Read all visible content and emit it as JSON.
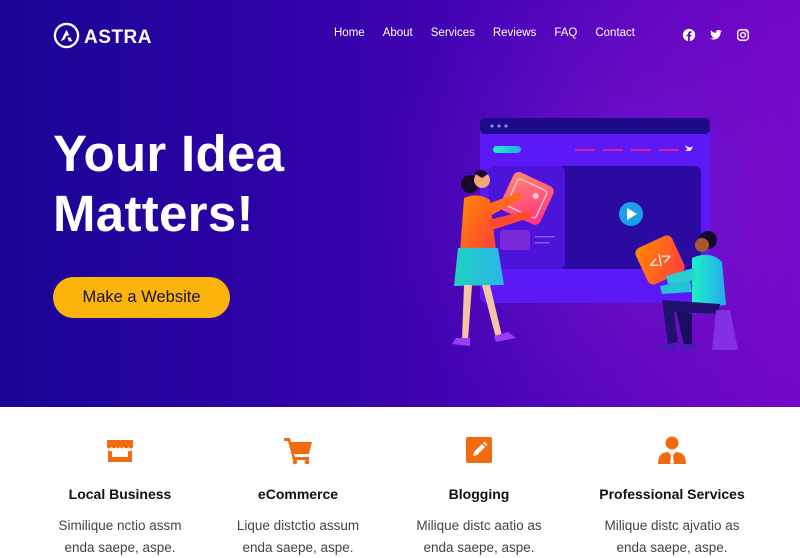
{
  "brand": {
    "name": "ASTRA"
  },
  "nav": {
    "items": [
      {
        "label": "Home"
      },
      {
        "label": "About"
      },
      {
        "label": "Services"
      },
      {
        "label": "Reviews"
      },
      {
        "label": "FAQ"
      },
      {
        "label": "Contact"
      }
    ],
    "social": [
      {
        "icon": "facebook-icon"
      },
      {
        "icon": "twitter-icon"
      },
      {
        "icon": "instagram-icon"
      }
    ]
  },
  "hero": {
    "headline_line1": "Your Idea",
    "headline_line2": "Matters!",
    "cta_label": "Make a Website",
    "illustration": "people-building-website-illustration"
  },
  "features": [
    {
      "icon": "storefront-icon",
      "title": "Local Business",
      "line1": "Similique nctio assm",
      "line2": "enda saepe, aspe."
    },
    {
      "icon": "shopping-cart-icon",
      "title": "eCommerce",
      "line1": "Lique distctio assum",
      "line2": "enda saepe, aspe."
    },
    {
      "icon": "pencil-square-icon",
      "title": "Blogging",
      "line1": "Milique distc aatio as",
      "line2": "enda saepe, aspe."
    },
    {
      "icon": "businessman-icon",
      "title": "Professional Services",
      "line1": "Milique distc ajvatio as",
      "line2": "enda saepe, aspe."
    }
  ],
  "colors": {
    "hero_gradient_start": "#1a0595",
    "hero_gradient_end": "#7406c8",
    "cta": "#fbb40c",
    "feature_icon": "#f26b0f"
  }
}
